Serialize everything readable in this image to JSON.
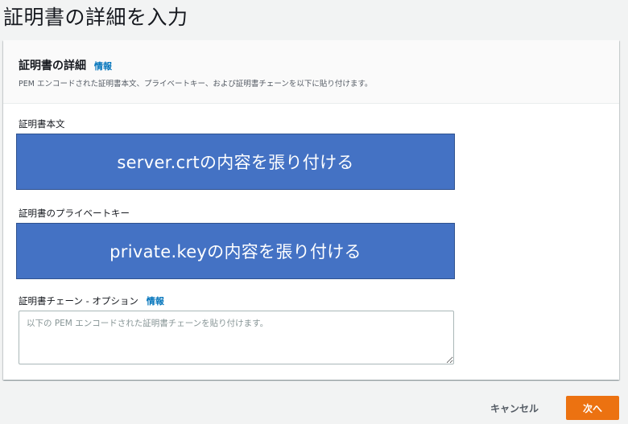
{
  "page": {
    "title": "証明書の詳細を入力"
  },
  "panel": {
    "title": "証明書の詳細",
    "info_label": "情報",
    "description": "PEM エンコードされた証明書本文、プライベートキー、および証明書チェーンを以下に貼り付けます。"
  },
  "fields": {
    "body": {
      "label": "証明書本文",
      "overlay": "server.crtの内容を張り付ける"
    },
    "private_key": {
      "label": "証明書のプライベートキー",
      "overlay": "private.keyの内容を張り付ける"
    },
    "chain": {
      "label": "証明書チェーン - オプション",
      "info_label": "情報",
      "placeholder": "以下の PEM エンコードされた証明書チェーンを貼り付けます。"
    }
  },
  "actions": {
    "cancel_label": "キャンセル",
    "next_label": "次へ"
  },
  "colors": {
    "accent": "#ec7211",
    "link": "#0073bb",
    "overlay": "#4472c4"
  }
}
